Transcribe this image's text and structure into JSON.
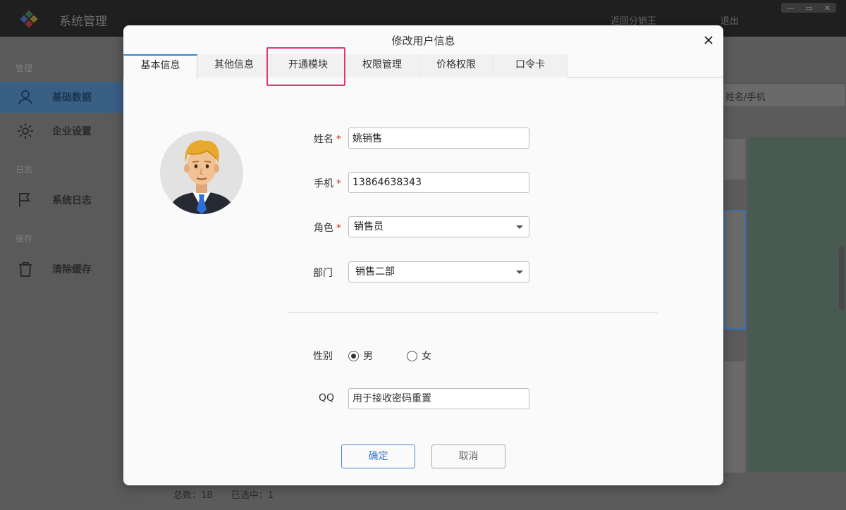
{
  "app": {
    "title": "系统管理",
    "back_link": "返回分销王",
    "exit_link": "退出",
    "window_controls": [
      "—",
      "▭",
      "✕"
    ]
  },
  "sidebar": {
    "sections": [
      {
        "label": "管理",
        "items": [
          {
            "label": "基础数据",
            "icon": "user-icon",
            "active": true
          },
          {
            "label": "企业设置",
            "icon": "gear-icon",
            "active": false
          }
        ]
      },
      {
        "label": "日志",
        "items": [
          {
            "label": "系统日志",
            "icon": "flag-icon",
            "active": false
          }
        ]
      },
      {
        "label": "缓存",
        "items": [
          {
            "label": "清除缓存",
            "icon": "trash-icon",
            "active": false
          }
        ]
      }
    ]
  },
  "main": {
    "search_placeholder": "姓名/手机",
    "footer": {
      "total": "总数：18",
      "selected": "已选中：1"
    }
  },
  "modal": {
    "title": "修改用户信息",
    "tabs": [
      {
        "label": "基本信息",
        "active": true
      },
      {
        "label": "其他信息",
        "active": false
      },
      {
        "label": "开通模块",
        "active": false,
        "highlighted": true
      },
      {
        "label": "权限管理",
        "active": false
      },
      {
        "label": "价格权限",
        "active": false
      },
      {
        "label": "口令卡",
        "active": false
      }
    ],
    "form": {
      "name": {
        "label": "姓名",
        "required_mark": "*",
        "value": "姚销售"
      },
      "phone": {
        "label": "手机",
        "required_mark": "*",
        "value": "13864638343"
      },
      "role": {
        "label": "角色",
        "required_mark": "*",
        "value": "销售员"
      },
      "department": {
        "label": "部门",
        "value": "销售二部"
      },
      "gender": {
        "label": "性别",
        "options": [
          "男",
          "女"
        ],
        "selected": "男"
      },
      "qq": {
        "label": "QQ",
        "placeholder": "用于接收密码重置"
      }
    },
    "buttons": {
      "ok": "确定",
      "cancel": "取消"
    },
    "colors": {
      "accent": "#3a82cf",
      "highlight": "#e33473",
      "required": "#c0392b"
    }
  }
}
